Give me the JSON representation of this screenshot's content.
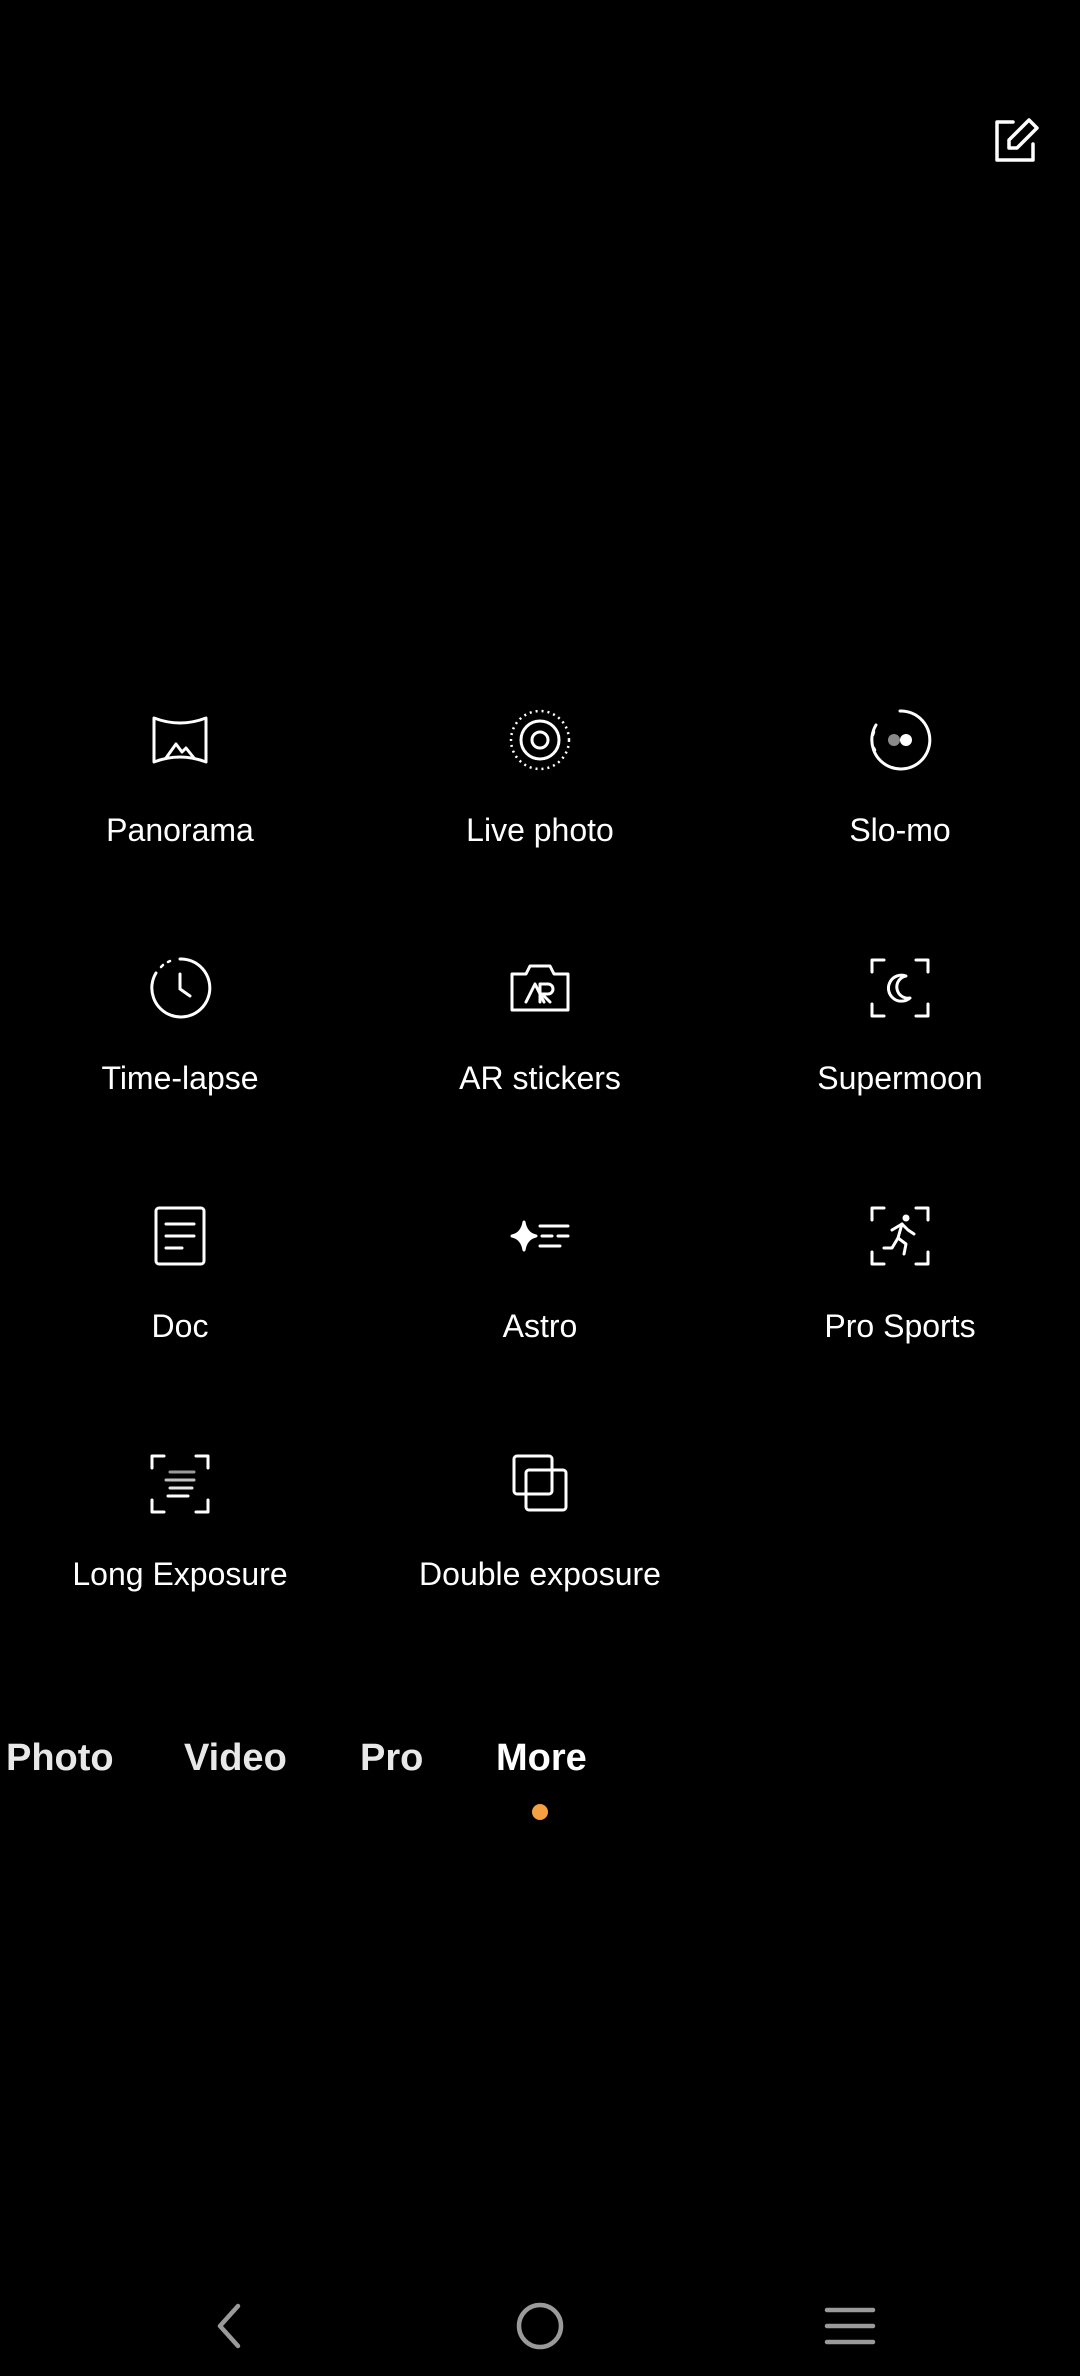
{
  "accent_color": "#f5a142",
  "toolbar": {
    "edit_icon": "edit-square-icon"
  },
  "modes": [
    {
      "label": "Panorama",
      "icon": "panorama-icon"
    },
    {
      "label": "Live photo",
      "icon": "live-photo-icon"
    },
    {
      "label": "Slo-mo",
      "icon": "slow-motion-icon"
    },
    {
      "label": "Time-lapse",
      "icon": "time-lapse-icon"
    },
    {
      "label": "AR stickers",
      "icon": "ar-camera-icon"
    },
    {
      "label": "Supermoon",
      "icon": "moon-frame-icon"
    },
    {
      "label": "Doc",
      "icon": "document-icon"
    },
    {
      "label": "Astro",
      "icon": "star-trails-icon"
    },
    {
      "label": "Pro Sports",
      "icon": "running-person-frame-icon"
    },
    {
      "label": "Long Exposure",
      "icon": "long-exposure-frame-icon"
    },
    {
      "label": "Double exposure",
      "icon": "overlapping-squares-icon"
    }
  ],
  "tabs": [
    {
      "label": "Photo"
    },
    {
      "label": "Video"
    },
    {
      "label": "Pro"
    },
    {
      "label": "More",
      "active": true
    }
  ],
  "navigation": {
    "back_icon": "back-chevron-icon",
    "home_icon": "home-circle-icon",
    "recent_icon": "menu-lines-icon"
  }
}
